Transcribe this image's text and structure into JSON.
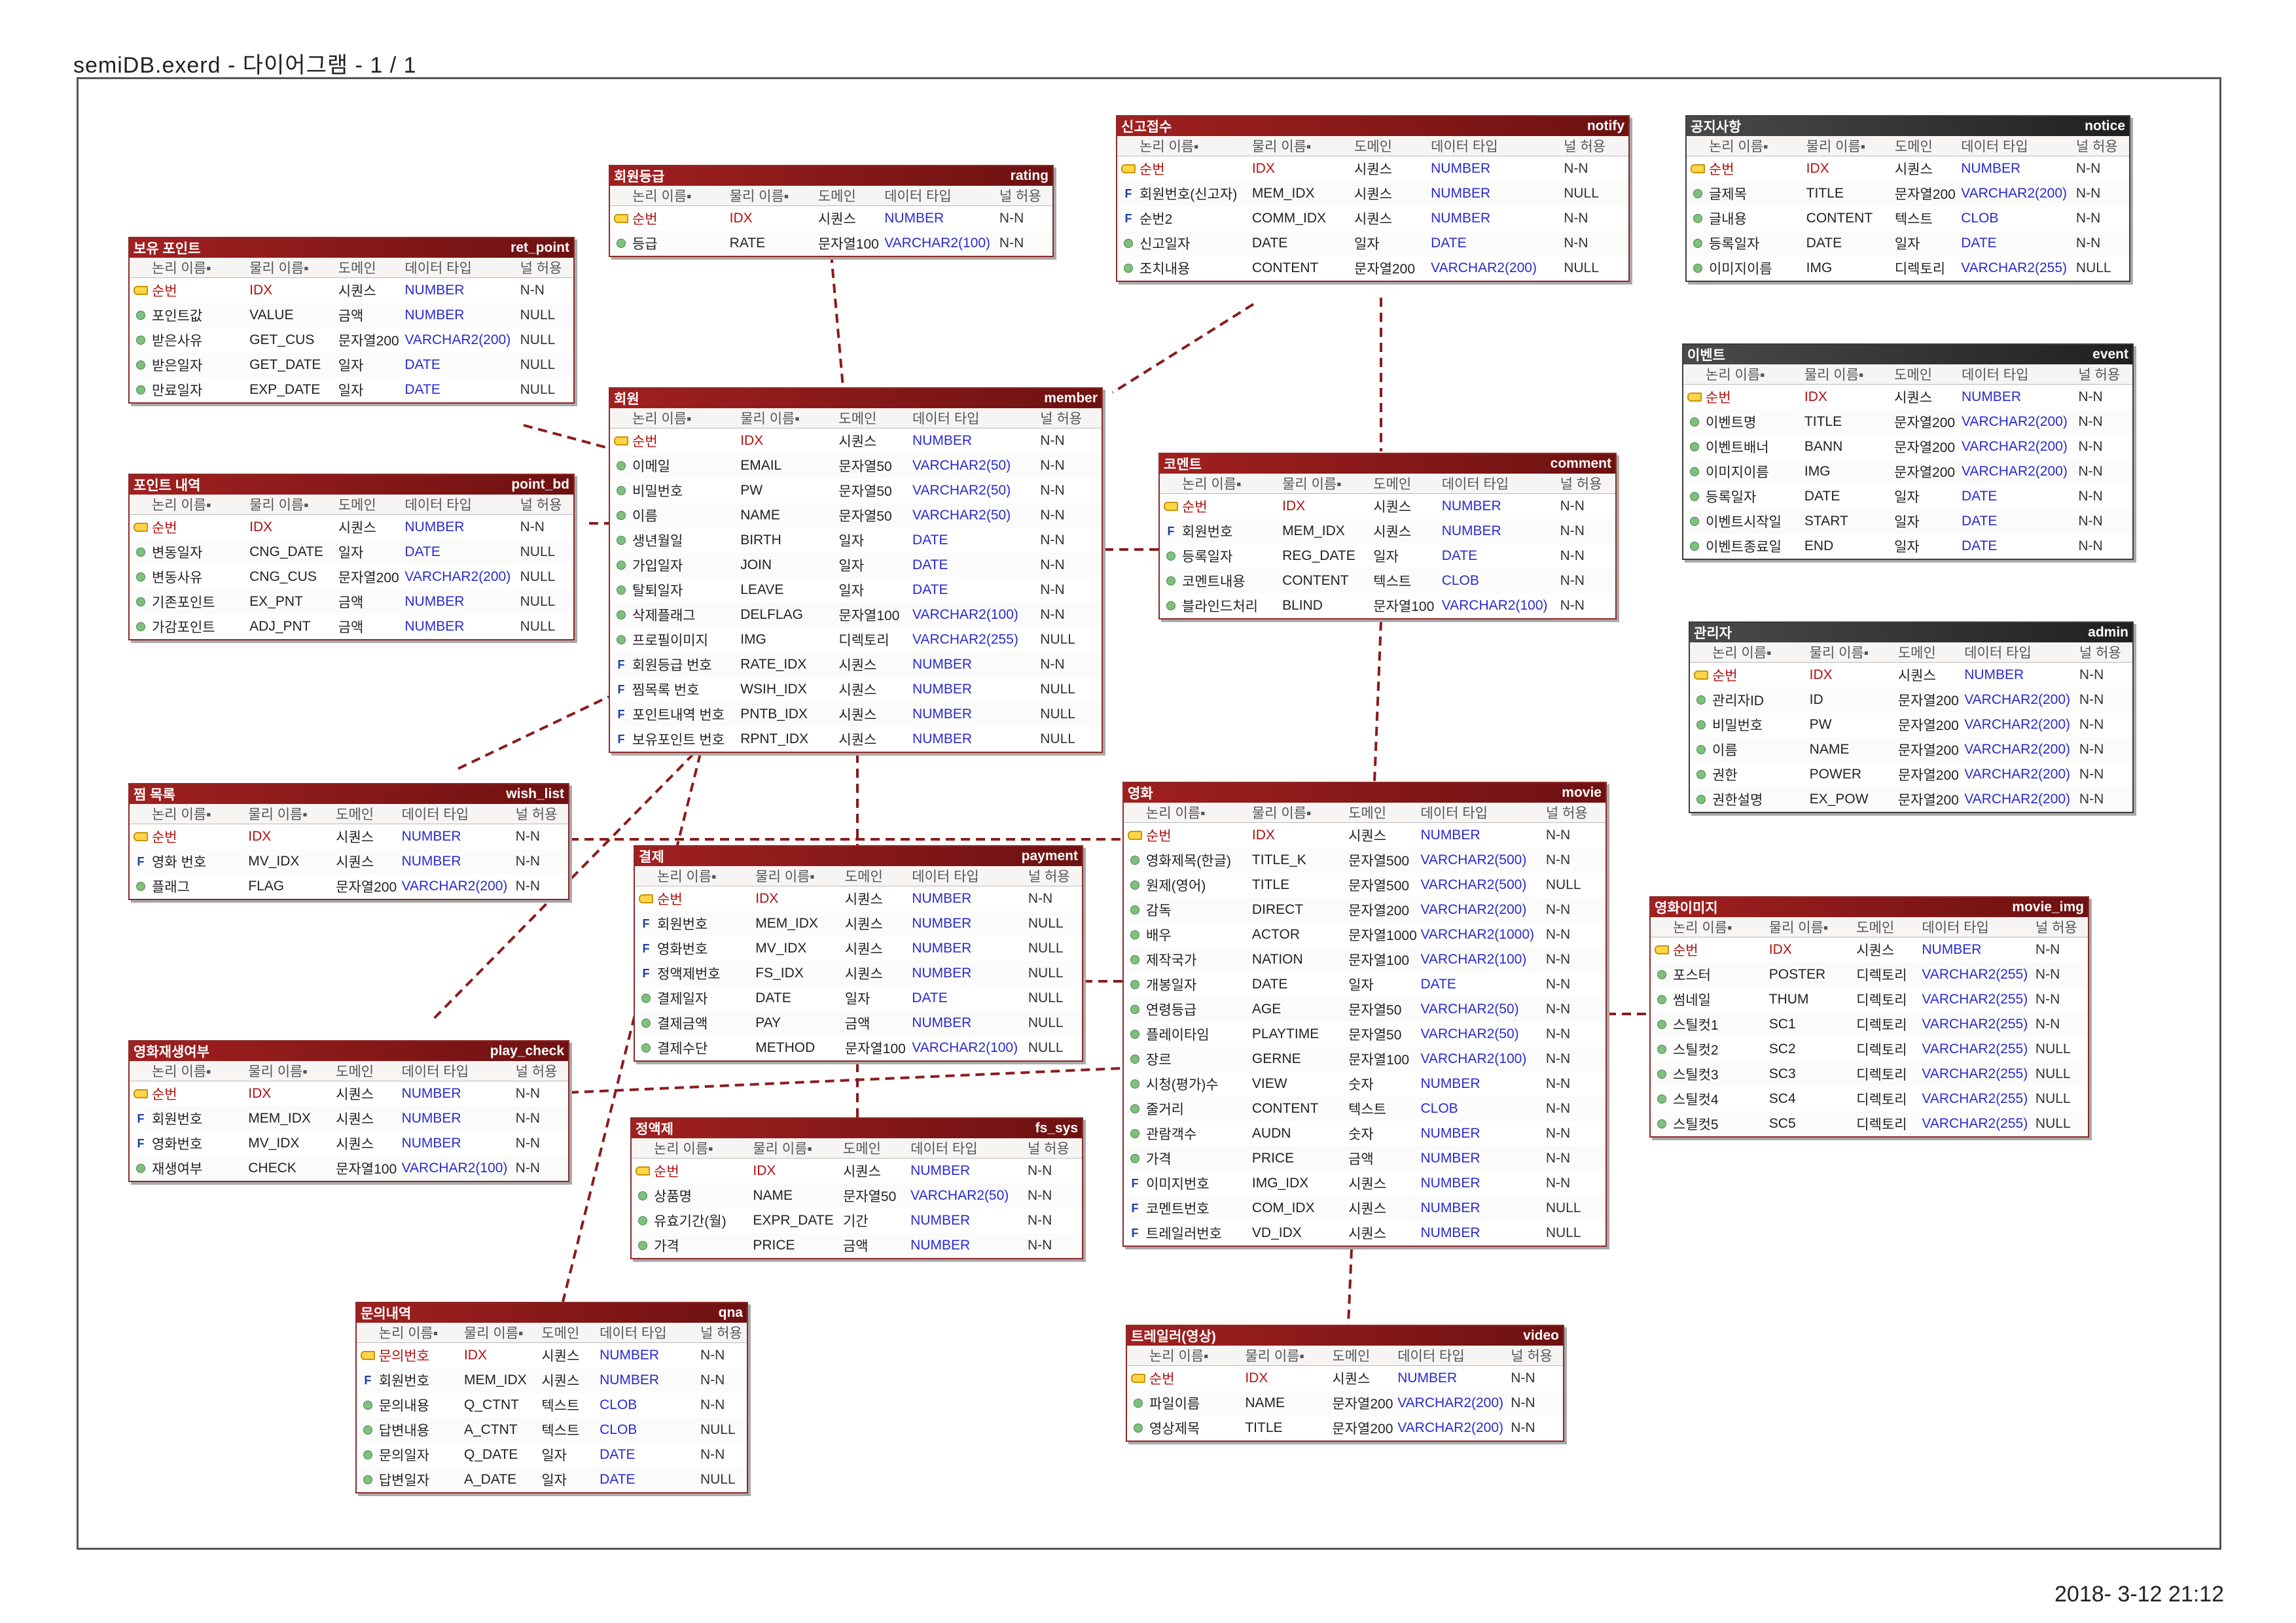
{
  "document": {
    "title": "semiDB.exerd - 다이어그램 - 1 / 1",
    "date": "2018- 3-12 21:12"
  },
  "column_headers": {
    "logical": "논리 이름▪",
    "physical": "물리 이름▪",
    "domain": "도메인",
    "type": "데이터 타입",
    "nullable": "널 허용"
  },
  "tables": [
    {
      "logical": "보유 포인트",
      "physical": "ret_point",
      "columns": [
        {
          "k": "pk",
          "l": "순번",
          "p": "IDX",
          "d": "시퀀스",
          "t": "NUMBER",
          "n": "N-N"
        },
        {
          "k": "at",
          "l": "포인트값",
          "p": "VALUE",
          "d": "금액",
          "t": "NUMBER",
          "n": "NULL"
        },
        {
          "k": "at",
          "l": "받은사유",
          "p": "GET_CUS",
          "d": "문자열200",
          "t": "VARCHAR2(200)",
          "n": "NULL"
        },
        {
          "k": "at",
          "l": "받은일자",
          "p": "GET_DATE",
          "d": "일자",
          "t": "DATE",
          "n": "NULL"
        },
        {
          "k": "at",
          "l": "만료일자",
          "p": "EXP_DATE",
          "d": "일자",
          "t": "DATE",
          "n": "NULL"
        }
      ]
    },
    {
      "logical": "포인트 내역",
      "physical": "point_bd",
      "columns": [
        {
          "k": "pk",
          "l": "순번",
          "p": "IDX",
          "d": "시퀀스",
          "t": "NUMBER",
          "n": "N-N"
        },
        {
          "k": "at",
          "l": "변동일자",
          "p": "CNG_DATE",
          "d": "일자",
          "t": "DATE",
          "n": "NULL"
        },
        {
          "k": "at",
          "l": "변동사유",
          "p": "CNG_CUS",
          "d": "문자열200",
          "t": "VARCHAR2(200)",
          "n": "NULL"
        },
        {
          "k": "at",
          "l": "기존포인트",
          "p": "EX_PNT",
          "d": "금액",
          "t": "NUMBER",
          "n": "NULL"
        },
        {
          "k": "at",
          "l": "가감포인트",
          "p": "ADJ_PNT",
          "d": "금액",
          "t": "NUMBER",
          "n": "NULL"
        }
      ]
    },
    {
      "logical": "찜 목록",
      "physical": "wish_list",
      "columns": [
        {
          "k": "pk",
          "l": "순번",
          "p": "IDX",
          "d": "시퀀스",
          "t": "NUMBER",
          "n": "N-N"
        },
        {
          "k": "fk",
          "l": "영화 번호",
          "p": "MV_IDX",
          "d": "시퀀스",
          "t": "NUMBER",
          "n": "N-N"
        },
        {
          "k": "at",
          "l": "플래그",
          "p": "FLAG",
          "d": "문자열200",
          "t": "VARCHAR2(200)",
          "n": "N-N"
        }
      ]
    },
    {
      "logical": "영화재생여부",
      "physical": "play_check",
      "columns": [
        {
          "k": "pk",
          "l": "순번",
          "p": "IDX",
          "d": "시퀀스",
          "t": "NUMBER",
          "n": "N-N"
        },
        {
          "k": "fk",
          "l": "회원번호",
          "p": "MEM_IDX",
          "d": "시퀀스",
          "t": "NUMBER",
          "n": "N-N"
        },
        {
          "k": "fk",
          "l": "영화번호",
          "p": "MV_IDX",
          "d": "시퀀스",
          "t": "NUMBER",
          "n": "N-N"
        },
        {
          "k": "at",
          "l": "재생여부",
          "p": "CHECK",
          "d": "문자열100",
          "t": "VARCHAR2(100)",
          "n": "N-N"
        }
      ]
    },
    {
      "logical": "회원등급",
      "physical": "rating",
      "columns": [
        {
          "k": "pk",
          "l": "순번",
          "p": "IDX",
          "d": "시퀀스",
          "t": "NUMBER",
          "n": "N-N"
        },
        {
          "k": "at",
          "l": "등급",
          "p": "RATE",
          "d": "문자열100",
          "t": "VARCHAR2(100)",
          "n": "N-N"
        }
      ]
    },
    {
      "logical": "회원",
      "physical": "member",
      "columns": [
        {
          "k": "pk",
          "l": "순번",
          "p": "IDX",
          "d": "시퀀스",
          "t": "NUMBER",
          "n": "N-N"
        },
        {
          "k": "at",
          "l": "이메일",
          "p": "EMAIL",
          "d": "문자열50",
          "t": "VARCHAR2(50)",
          "n": "N-N"
        },
        {
          "k": "at",
          "l": "비밀번호",
          "p": "PW",
          "d": "문자열50",
          "t": "VARCHAR2(50)",
          "n": "N-N"
        },
        {
          "k": "at",
          "l": "이름",
          "p": "NAME",
          "d": "문자열50",
          "t": "VARCHAR2(50)",
          "n": "N-N"
        },
        {
          "k": "at",
          "l": "생년월일",
          "p": "BIRTH",
          "d": "일자",
          "t": "DATE",
          "n": "N-N"
        },
        {
          "k": "at",
          "l": "가입일자",
          "p": "JOIN",
          "d": "일자",
          "t": "DATE",
          "n": "N-N"
        },
        {
          "k": "at",
          "l": "탈퇴일자",
          "p": "LEAVE",
          "d": "일자",
          "t": "DATE",
          "n": "N-N"
        },
        {
          "k": "at",
          "l": "삭제플래그",
          "p": "DELFLAG",
          "d": "문자열100",
          "t": "VARCHAR2(100)",
          "n": "N-N"
        },
        {
          "k": "at",
          "l": "프로필이미지",
          "p": "IMG",
          "d": "디렉토리",
          "t": "VARCHAR2(255)",
          "n": "NULL"
        },
        {
          "k": "fk",
          "l": "회원등급 번호",
          "p": "RATE_IDX",
          "d": "시퀀스",
          "t": "NUMBER",
          "n": "N-N"
        },
        {
          "k": "fk",
          "l": "찜목록 번호",
          "p": "WSIH_IDX",
          "d": "시퀀스",
          "t": "NUMBER",
          "n": "NULL"
        },
        {
          "k": "fk",
          "l": "포인트내역 번호",
          "p": "PNTB_IDX",
          "d": "시퀀스",
          "t": "NUMBER",
          "n": "NULL"
        },
        {
          "k": "fk",
          "l": "보유포인트 번호",
          "p": "RPNT_IDX",
          "d": "시퀀스",
          "t": "NUMBER",
          "n": "NULL"
        }
      ]
    },
    {
      "logical": "결제",
      "physical": "payment",
      "columns": [
        {
          "k": "pk",
          "l": "순번",
          "p": "IDX",
          "d": "시퀀스",
          "t": "NUMBER",
          "n": "N-N"
        },
        {
          "k": "fk",
          "l": "회원번호",
          "p": "MEM_IDX",
          "d": "시퀀스",
          "t": "NUMBER",
          "n": "NULL"
        },
        {
          "k": "fk",
          "l": "영화번호",
          "p": "MV_IDX",
          "d": "시퀀스",
          "t": "NUMBER",
          "n": "NULL"
        },
        {
          "k": "fk",
          "l": "정액제번호",
          "p": "FS_IDX",
          "d": "시퀀스",
          "t": "NUMBER",
          "n": "NULL"
        },
        {
          "k": "at",
          "l": "결제일자",
          "p": "DATE",
          "d": "일자",
          "t": "DATE",
          "n": "NULL"
        },
        {
          "k": "at",
          "l": "결제금액",
          "p": "PAY",
          "d": "금액",
          "t": "NUMBER",
          "n": "NULL"
        },
        {
          "k": "at",
          "l": "결제수단",
          "p": "METHOD",
          "d": "문자열100",
          "t": "VARCHAR2(100)",
          "n": "NULL"
        }
      ]
    },
    {
      "logical": "정액제",
      "physical": "fs_sys",
      "columns": [
        {
          "k": "pk",
          "l": "순번",
          "p": "IDX",
          "d": "시퀀스",
          "t": "NUMBER",
          "n": "N-N"
        },
        {
          "k": "at",
          "l": "상품명",
          "p": "NAME",
          "d": "문자열50",
          "t": "VARCHAR2(50)",
          "n": "N-N"
        },
        {
          "k": "at",
          "l": "유효기간(월)",
          "p": "EXPR_DATE",
          "d": "기간",
          "t": "NUMBER",
          "n": "N-N"
        },
        {
          "k": "at",
          "l": "가격",
          "p": "PRICE",
          "d": "금액",
          "t": "NUMBER",
          "n": "N-N"
        }
      ]
    },
    {
      "logical": "문의내역",
      "physical": "qna",
      "columns": [
        {
          "k": "pk",
          "l": "문의번호",
          "p": "IDX",
          "d": "시퀀스",
          "t": "NUMBER",
          "n": "N-N"
        },
        {
          "k": "fk",
          "l": "회원번호",
          "p": "MEM_IDX",
          "d": "시퀀스",
          "t": "NUMBER",
          "n": "N-N"
        },
        {
          "k": "at",
          "l": "문의내용",
          "p": "Q_CTNT",
          "d": "텍스트",
          "t": "CLOB",
          "n": "N-N"
        },
        {
          "k": "at",
          "l": "답변내용",
          "p": "A_CTNT",
          "d": "텍스트",
          "t": "CLOB",
          "n": "NULL"
        },
        {
          "k": "at",
          "l": "문의일자",
          "p": "Q_DATE",
          "d": "일자",
          "t": "DATE",
          "n": "N-N"
        },
        {
          "k": "at",
          "l": "답변일자",
          "p": "A_DATE",
          "d": "일자",
          "t": "DATE",
          "n": "NULL"
        }
      ]
    },
    {
      "logical": "신고접수",
      "physical": "notify",
      "columns": [
        {
          "k": "pk",
          "l": "순번",
          "p": "IDX",
          "d": "시퀀스",
          "t": "NUMBER",
          "n": "N-N"
        },
        {
          "k": "fk",
          "l": "회원번호(신고자)",
          "p": "MEM_IDX",
          "d": "시퀀스",
          "t": "NUMBER",
          "n": "NULL"
        },
        {
          "k": "fk",
          "l": "순번2",
          "p": "COMM_IDX",
          "d": "시퀀스",
          "t": "NUMBER",
          "n": "N-N"
        },
        {
          "k": "at",
          "l": "신고일자",
          "p": "DATE",
          "d": "일자",
          "t": "DATE",
          "n": "N-N"
        },
        {
          "k": "at",
          "l": "조치내용",
          "p": "CONTENT",
          "d": "문자열200",
          "t": "VARCHAR2(200)",
          "n": "NULL"
        }
      ]
    },
    {
      "logical": "코멘트",
      "physical": "comment",
      "columns": [
        {
          "k": "pk",
          "l": "순번",
          "p": "IDX",
          "d": "시퀀스",
          "t": "NUMBER",
          "n": "N-N"
        },
        {
          "k": "fk",
          "l": "회원번호",
          "p": "MEM_IDX",
          "d": "시퀀스",
          "t": "NUMBER",
          "n": "N-N"
        },
        {
          "k": "at",
          "l": "등록일자",
          "p": "REG_DATE",
          "d": "일자",
          "t": "DATE",
          "n": "N-N"
        },
        {
          "k": "at",
          "l": "코멘트내용",
          "p": "CONTENT",
          "d": "텍스트",
          "t": "CLOB",
          "n": "N-N"
        },
        {
          "k": "at",
          "l": "블라인드처리",
          "p": "BLIND",
          "d": "문자열100",
          "t": "VARCHAR2(100)",
          "n": "N-N"
        }
      ]
    },
    {
      "logical": "영화",
      "physical": "movie",
      "columns": [
        {
          "k": "pk",
          "l": "순번",
          "p": "IDX",
          "d": "시퀀스",
          "t": "NUMBER",
          "n": "N-N"
        },
        {
          "k": "at",
          "l": "영화제목(한글)",
          "p": "TITLE_K",
          "d": "문자열500",
          "t": "VARCHAR2(500)",
          "n": "N-N"
        },
        {
          "k": "at",
          "l": "원제(영어)",
          "p": "TITLE",
          "d": "문자열500",
          "t": "VARCHAR2(500)",
          "n": "NULL"
        },
        {
          "k": "at",
          "l": "감독",
          "p": "DIRECT",
          "d": "문자열200",
          "t": "VARCHAR2(200)",
          "n": "N-N"
        },
        {
          "k": "at",
          "l": "배우",
          "p": "ACTOR",
          "d": "문자열1000",
          "t": "VARCHAR2(1000)",
          "n": "N-N"
        },
        {
          "k": "at",
          "l": "제작국가",
          "p": "NATION",
          "d": "문자열100",
          "t": "VARCHAR2(100)",
          "n": "N-N"
        },
        {
          "k": "at",
          "l": "개봉일자",
          "p": "DATE",
          "d": "일자",
          "t": "DATE",
          "n": "N-N"
        },
        {
          "k": "at",
          "l": "연령등급",
          "p": "AGE",
          "d": "문자열50",
          "t": "VARCHAR2(50)",
          "n": "N-N"
        },
        {
          "k": "at",
          "l": "플레이타임",
          "p": "PLAYTIME",
          "d": "문자열50",
          "t": "VARCHAR2(50)",
          "n": "N-N"
        },
        {
          "k": "at",
          "l": "장르",
          "p": "GERNE",
          "d": "문자열100",
          "t": "VARCHAR2(100)",
          "n": "N-N"
        },
        {
          "k": "at",
          "l": "시청(평가)수",
          "p": "VIEW",
          "d": "숫자",
          "t": "NUMBER",
          "n": "N-N"
        },
        {
          "k": "at",
          "l": "줄거리",
          "p": "CONTENT",
          "d": "텍스트",
          "t": "CLOB",
          "n": "N-N"
        },
        {
          "k": "at",
          "l": "관람객수",
          "p": "AUDN",
          "d": "숫자",
          "t": "NUMBER",
          "n": "N-N"
        },
        {
          "k": "at",
          "l": "가격",
          "p": "PRICE",
          "d": "금액",
          "t": "NUMBER",
          "n": "N-N"
        },
        {
          "k": "fk",
          "l": "이미지번호",
          "p": "IMG_IDX",
          "d": "시퀀스",
          "t": "NUMBER",
          "n": "N-N"
        },
        {
          "k": "fk",
          "l": "코멘트번호",
          "p": "COM_IDX",
          "d": "시퀀스",
          "t": "NUMBER",
          "n": "NULL"
        },
        {
          "k": "fk",
          "l": "트레일러번호",
          "p": "VD_IDX",
          "d": "시퀀스",
          "t": "NUMBER",
          "n": "NULL"
        }
      ]
    },
    {
      "logical": "트레일러(영상)",
      "physical": "video",
      "columns": [
        {
          "k": "pk",
          "l": "순번",
          "p": "IDX",
          "d": "시퀀스",
          "t": "NUMBER",
          "n": "N-N"
        },
        {
          "k": "at",
          "l": "파일이름",
          "p": "NAME",
          "d": "문자열200",
          "t": "VARCHAR2(200)",
          "n": "N-N"
        },
        {
          "k": "at",
          "l": "영상제목",
          "p": "TITLE",
          "d": "문자열200",
          "t": "VARCHAR2(200)",
          "n": "N-N"
        }
      ]
    },
    {
      "logical": "공지사항",
      "physical": "notice",
      "gray": true,
      "columns": [
        {
          "k": "pk",
          "l": "순번",
          "p": "IDX",
          "d": "시퀀스",
          "t": "NUMBER",
          "n": "N-N"
        },
        {
          "k": "at",
          "l": "글제목",
          "p": "TITLE",
          "d": "문자열200",
          "t": "VARCHAR2(200)",
          "n": "N-N"
        },
        {
          "k": "at",
          "l": "글내용",
          "p": "CONTENT",
          "d": "텍스트",
          "t": "CLOB",
          "n": "N-N"
        },
        {
          "k": "at",
          "l": "등록일자",
          "p": "DATE",
          "d": "일자",
          "t": "DATE",
          "n": "N-N"
        },
        {
          "k": "at",
          "l": "이미지이름",
          "p": "IMG",
          "d": "디렉토리",
          "t": "VARCHAR2(255)",
          "n": "NULL"
        }
      ]
    },
    {
      "logical": "이벤트",
      "physical": "event",
      "gray": true,
      "columns": [
        {
          "k": "pk",
          "l": "순번",
          "p": "IDX",
          "d": "시퀀스",
          "t": "NUMBER",
          "n": "N-N"
        },
        {
          "k": "at",
          "l": "이벤트명",
          "p": "TITLE",
          "d": "문자열200",
          "t": "VARCHAR2(200)",
          "n": "N-N"
        },
        {
          "k": "at",
          "l": "이벤트배너",
          "p": "BANN",
          "d": "문자열200",
          "t": "VARCHAR2(200)",
          "n": "N-N"
        },
        {
          "k": "at",
          "l": "이미지이름",
          "p": "IMG",
          "d": "문자열200",
          "t": "VARCHAR2(200)",
          "n": "N-N"
        },
        {
          "k": "at",
          "l": "등록일자",
          "p": "DATE",
          "d": "일자",
          "t": "DATE",
          "n": "N-N"
        },
        {
          "k": "at",
          "l": "이벤트시작일",
          "p": "START",
          "d": "일자",
          "t": "DATE",
          "n": "N-N"
        },
        {
          "k": "at",
          "l": "이벤트종료일",
          "p": "END",
          "d": "일자",
          "t": "DATE",
          "n": "N-N"
        }
      ]
    },
    {
      "logical": "관리자",
      "physical": "admin",
      "gray": true,
      "columns": [
        {
          "k": "pk",
          "l": "순번",
          "p": "IDX",
          "d": "시퀀스",
          "t": "NUMBER",
          "n": "N-N"
        },
        {
          "k": "at",
          "l": "관리자ID",
          "p": "ID",
          "d": "문자열200",
          "t": "VARCHAR2(200)",
          "n": "N-N"
        },
        {
          "k": "at",
          "l": "비밀번호",
          "p": "PW",
          "d": "문자열200",
          "t": "VARCHAR2(200)",
          "n": "N-N"
        },
        {
          "k": "at",
          "l": "이름",
          "p": "NAME",
          "d": "문자열200",
          "t": "VARCHAR2(200)",
          "n": "N-N"
        },
        {
          "k": "at",
          "l": "권한",
          "p": "POWER",
          "d": "문자열200",
          "t": "VARCHAR2(200)",
          "n": "N-N"
        },
        {
          "k": "at",
          "l": "권한설명",
          "p": "EX_POW",
          "d": "문자열200",
          "t": "VARCHAR2(200)",
          "n": "N-N"
        }
      ]
    },
    {
      "logical": "영화이미지",
      "physical": "movie_img",
      "columns": [
        {
          "k": "pk",
          "l": "순번",
          "p": "IDX",
          "d": "시퀀스",
          "t": "NUMBER",
          "n": "N-N"
        },
        {
          "k": "at",
          "l": "포스터",
          "p": "POSTER",
          "d": "디렉토리",
          "t": "VARCHAR2(255)",
          "n": "N-N"
        },
        {
          "k": "at",
          "l": "썸네일",
          "p": "THUM",
          "d": "디렉토리",
          "t": "VARCHAR2(255)",
          "n": "N-N"
        },
        {
          "k": "at",
          "l": "스틸컷1",
          "p": "SC1",
          "d": "디렉토리",
          "t": "VARCHAR2(255)",
          "n": "N-N"
        },
        {
          "k": "at",
          "l": "스틸컷2",
          "p": "SC2",
          "d": "디렉토리",
          "t": "VARCHAR2(255)",
          "n": "NULL"
        },
        {
          "k": "at",
          "l": "스틸컷3",
          "p": "SC3",
          "d": "디렉토리",
          "t": "VARCHAR2(255)",
          "n": "NULL"
        },
        {
          "k": "at",
          "l": "스틸컷4",
          "p": "SC4",
          "d": "디렉토리",
          "t": "VARCHAR2(255)",
          "n": "NULL"
        },
        {
          "k": "at",
          "l": "스틸컷5",
          "p": "SC5",
          "d": "디렉토리",
          "t": "VARCHAR2(255)",
          "n": "NULL"
        }
      ]
    }
  ]
}
